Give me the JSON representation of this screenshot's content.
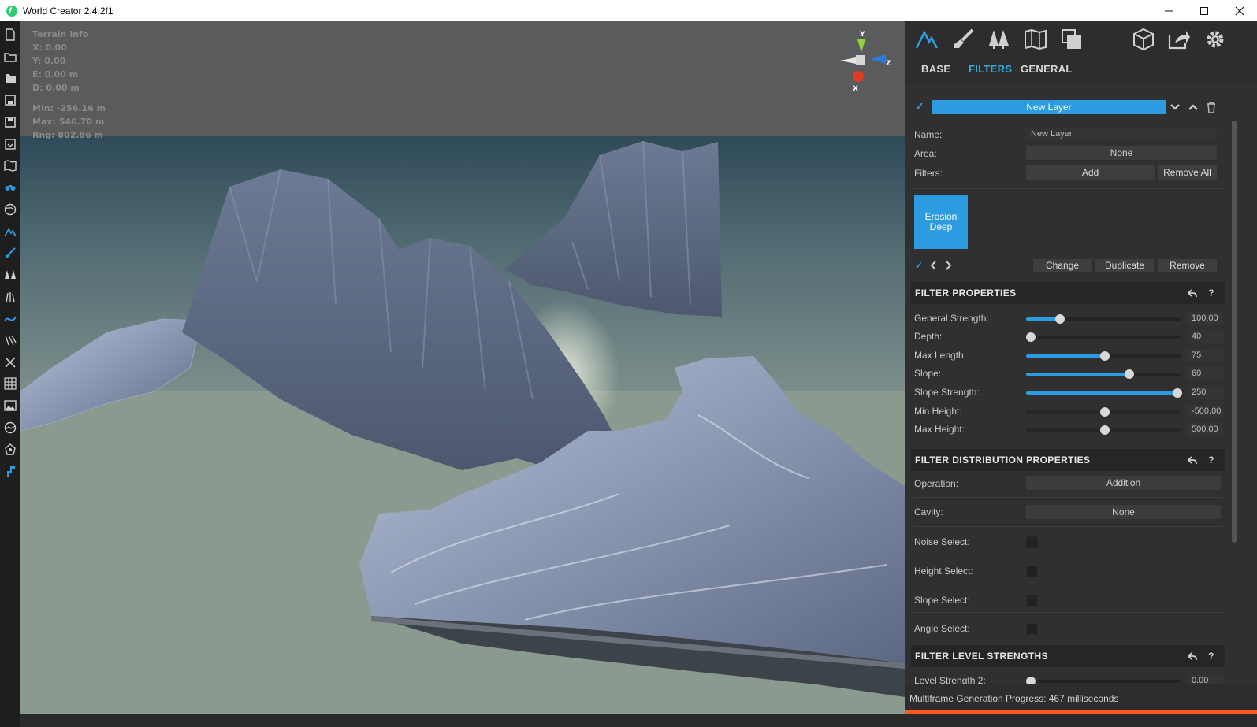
{
  "window": {
    "title": "World Creator 2.4.2f1",
    "minimize_icon": "minimize-icon",
    "maximize_icon": "maximize-icon",
    "close_icon": "close-icon"
  },
  "left_toolbar": {
    "tools": [
      {
        "name": "new-file-icon"
      },
      {
        "name": "open-folder-icon"
      },
      {
        "name": "open-recent-icon"
      },
      {
        "name": "save-icon"
      },
      {
        "name": "save-as-icon"
      },
      {
        "name": "import-icon"
      },
      {
        "name": "map-icon"
      },
      {
        "name": "camera-view-icon",
        "active": true
      },
      {
        "name": "globe-icon"
      },
      {
        "name": "terrain-icon",
        "active": true
      },
      {
        "name": "brush-icon",
        "active": true
      },
      {
        "name": "forest-icon"
      },
      {
        "name": "grass-icon"
      },
      {
        "name": "river-icon",
        "active": true
      },
      {
        "name": "path-icon"
      },
      {
        "name": "transform-icon"
      },
      {
        "name": "grid-icon"
      },
      {
        "name": "image-icon"
      },
      {
        "name": "environment-icon"
      },
      {
        "name": "light-icon"
      },
      {
        "name": "paint-icon",
        "active": true
      }
    ]
  },
  "terrain_info": {
    "title": "Terrain Info",
    "x": "X: 0.00",
    "y": "Y: 0.00",
    "e": "E: 0.00 m",
    "d": "D: 0.00 m",
    "min": "Min: -256.16 m",
    "max": "Max: 546.70 m",
    "rng": "Rng: 802.86 m"
  },
  "gizmo": {
    "y": "Y",
    "z": "Z",
    "x": "X"
  },
  "panel": {
    "top_icons": [
      "terrain-tab-icon",
      "sculpt-tab-icon",
      "vegetation-tab-icon",
      "map-tab-icon",
      "layers-tab-icon",
      "export-cube-icon",
      "share-icon",
      "settings-icon"
    ],
    "tabs": [
      {
        "label": "BASE",
        "active": false
      },
      {
        "label": "FILTERS",
        "active": true
      },
      {
        "label": "GENERAL",
        "active": false
      }
    ],
    "layer": {
      "name_button": "New Layer",
      "name_label": "Name:",
      "name_value": "New Layer",
      "area_label": "Area:",
      "area_value": "None",
      "filters_label": "Filters:",
      "add_label": "Add",
      "remove_all_label": "Remove All",
      "filter_tile": "Erosion Deep",
      "change_label": "Change",
      "duplicate_label": "Duplicate",
      "remove_label": "Remove"
    },
    "filter_properties": {
      "title": "FILTER PROPERTIES",
      "rows": [
        {
          "label": "General Strength:",
          "value": "100.00",
          "fraction": 0.22
        },
        {
          "label": "Depth:",
          "value": "40",
          "fraction": 0.03
        },
        {
          "label": "Max Length:",
          "value": "75",
          "fraction": 0.51
        },
        {
          "label": "Slope:",
          "value": "60",
          "fraction": 0.67
        },
        {
          "label": "Slope Strength:",
          "value": "250",
          "fraction": 0.98
        },
        {
          "label": "Min Height:",
          "value": "-500.00",
          "fraction": 0.51
        },
        {
          "label": "Max Height:",
          "value": "500.00",
          "fraction": 0.51
        }
      ]
    },
    "distribution": {
      "title": "FILTER DISTRIBUTION PROPERTIES",
      "operation_label": "Operation:",
      "operation_value": "Addition",
      "cavity_label": "Cavity:",
      "cavity_value": "None",
      "noise_select": "Noise Select:",
      "height_select": "Height Select:",
      "slope_select": "Slope Select:",
      "angle_select": "Angle Select:"
    },
    "level_strengths": {
      "title": "FILTER LEVEL STRENGTHS",
      "row_label": "Level Strength 2:",
      "row_value": "0.00"
    }
  },
  "status": {
    "text": "Multiframe Generation Progress: 467 milliseconds"
  },
  "colors": {
    "accent": "#2d9be0",
    "progress": "#ff5a1e",
    "panel_bg": "#303030"
  }
}
